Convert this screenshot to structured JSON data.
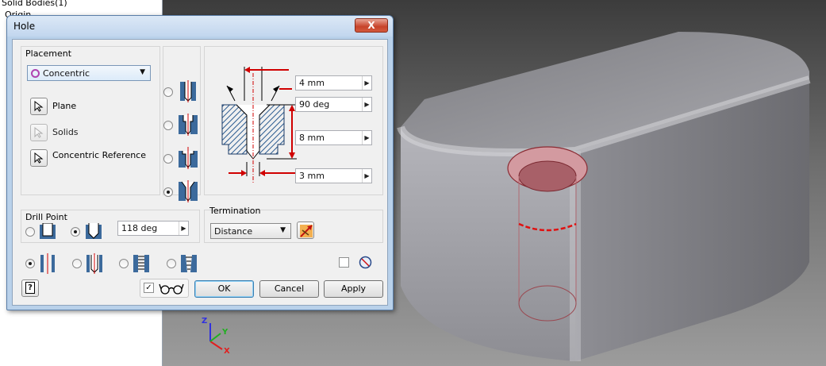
{
  "browser": {
    "tree_items": [
      "Solid Bodies(1)",
      "Origin"
    ]
  },
  "dialog": {
    "title": "Hole",
    "close_label": "X",
    "placement": {
      "group_label": "Placement",
      "type_value": "Concentric",
      "selectors": [
        {
          "label": "Plane",
          "enabled": true
        },
        {
          "label": "Solids",
          "enabled": false
        },
        {
          "label": "Concentric Reference",
          "enabled": true
        }
      ]
    },
    "hole_types": {
      "options": [
        "simple-hole",
        "counterbore",
        "spotface",
        "countersink"
      ],
      "selected_index": 3
    },
    "dimensions": {
      "countersink_diameter": "4 mm",
      "countersink_angle": "90 deg",
      "depth": "8 mm",
      "diameter": "3 mm"
    },
    "drill_point": {
      "group_label": "Drill Point",
      "options": [
        "flat",
        "angle"
      ],
      "selected_index": 1,
      "angle_value": "118 deg"
    },
    "termination": {
      "group_label": "Termination",
      "value": "Distance"
    },
    "thread_types": {
      "options": [
        "simple",
        "clearance",
        "tapped",
        "taper-tapped"
      ],
      "selected_index": 0
    },
    "preview_checked": true,
    "infer_checked": false,
    "buttons": {
      "ok": "OK",
      "cancel": "Cancel",
      "apply": "Apply",
      "help": "?"
    },
    "colors": {
      "dimension_arrow": "#d00000",
      "hole_highlight": "#c9737a"
    }
  },
  "viewcube_axes": [
    "X",
    "Y",
    "Z"
  ]
}
